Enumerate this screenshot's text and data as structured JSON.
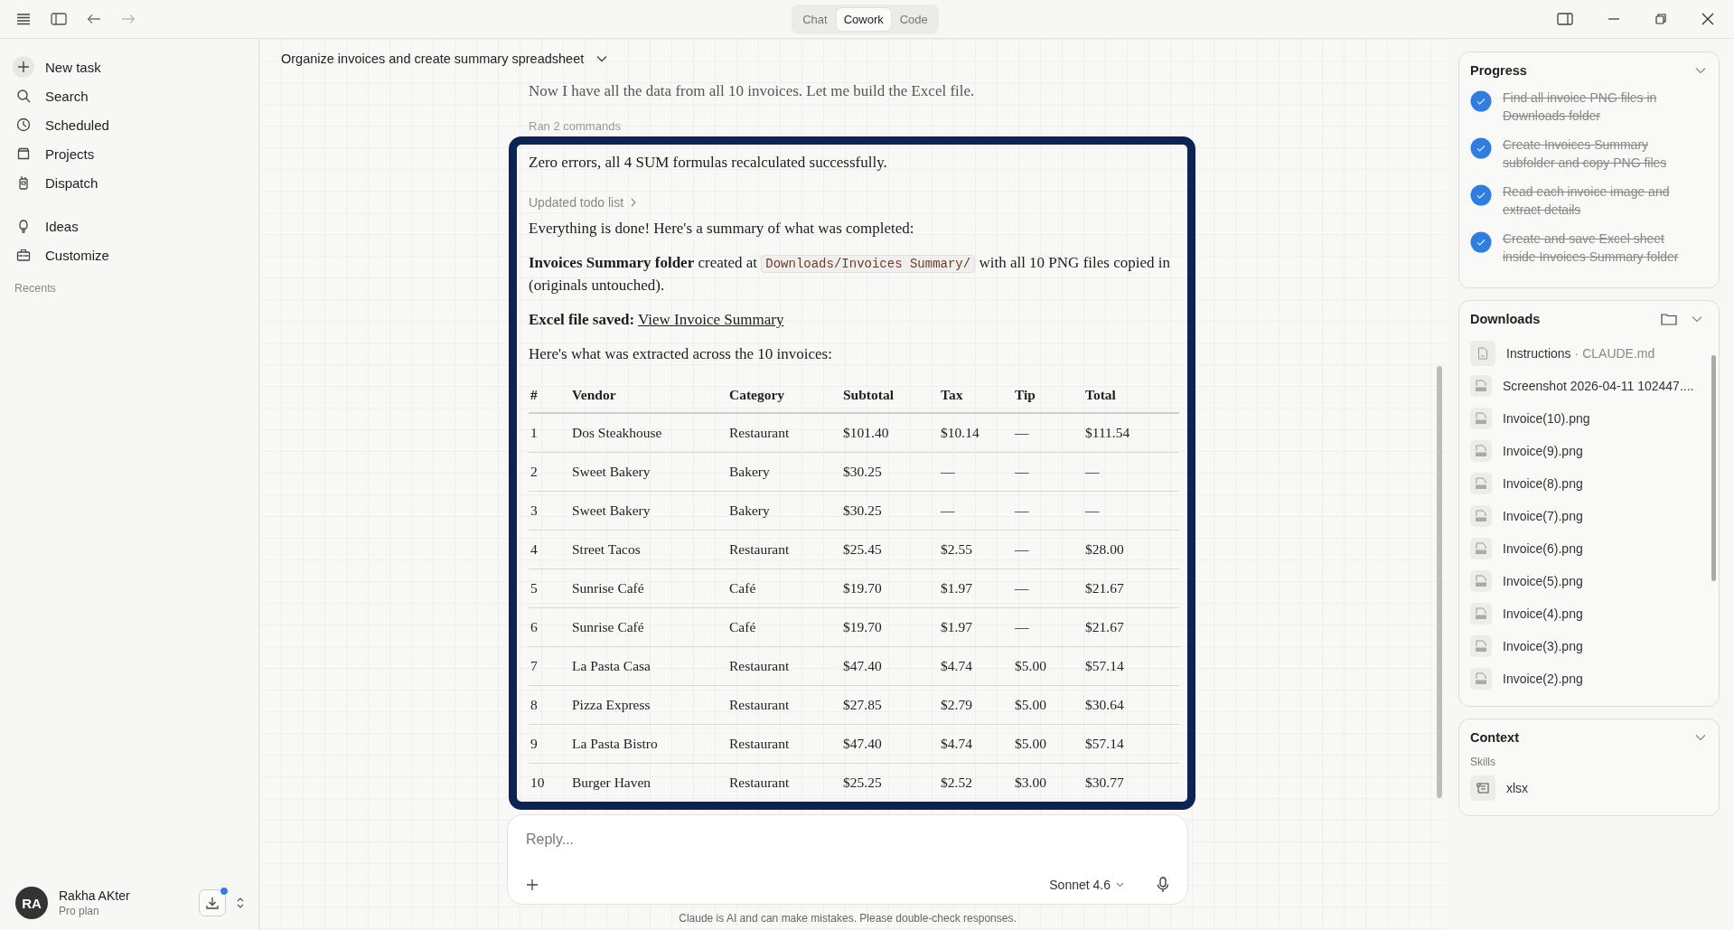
{
  "modes": [
    {
      "label": "Chat",
      "selected": false
    },
    {
      "label": "Cowork",
      "selected": true
    },
    {
      "label": "Code",
      "selected": false
    }
  ],
  "sidebar": {
    "primary": [
      {
        "label": "New task",
        "kind": "plus"
      },
      {
        "label": "Search",
        "kind": "search"
      },
      {
        "label": "Scheduled",
        "kind": "clock"
      },
      {
        "label": "Projects",
        "kind": "folder"
      },
      {
        "label": "Dispatch",
        "kind": "device"
      }
    ],
    "secondary": [
      {
        "label": "Ideas",
        "kind": "bulb"
      },
      {
        "label": "Customize",
        "kind": "toolbox"
      }
    ],
    "recents_label": "Recents",
    "user": {
      "initials": "RA",
      "name": "Rakha AKter",
      "plan": "Pro plan"
    }
  },
  "task_title": "Organize invoices and create summary spreadsheet",
  "chat": {
    "intro": "Now I have all the data from all 10 invoices. Let me build the Excel file.",
    "ran_commands": "Ran 2 commands",
    "result_line": "Zero errors, all 4 SUM formulas recalculated successfully.",
    "todo_link": "Updated todo list",
    "summary_line": "Everything is done! Here's a summary of what was completed:",
    "folder_line": {
      "bold": "Invoices Summary folder",
      "before_code": " created at ",
      "code": "Downloads/Invoices Summary/",
      "after_code": " with all 10 PNG files copied in (originals untouched)."
    },
    "excel_line": {
      "bold": "Excel file saved:",
      "link": "View Invoice Summary"
    },
    "extracted_line": "Here's what was extracted across the 10 invoices:",
    "table": {
      "columns": [
        "#",
        "Vendor",
        "Category",
        "Subtotal",
        "Tax",
        "Tip",
        "Total"
      ],
      "rows": [
        [
          "1",
          "Dos Steakhouse",
          "Restaurant",
          "$101.40",
          "$10.14",
          "—",
          "$111.54"
        ],
        [
          "2",
          "Sweet Bakery",
          "Bakery",
          "$30.25",
          "—",
          "—",
          "—"
        ],
        [
          "3",
          "Sweet Bakery",
          "Bakery",
          "$30.25",
          "—",
          "—",
          "—"
        ],
        [
          "4",
          "Street Tacos",
          "Restaurant",
          "$25.45",
          "$2.55",
          "—",
          "$28.00"
        ],
        [
          "5",
          "Sunrise Café",
          "Café",
          "$19.70",
          "$1.97",
          "—",
          "$21.67"
        ],
        [
          "6",
          "Sunrise Café",
          "Café",
          "$19.70",
          "$1.97",
          "—",
          "$21.67"
        ],
        [
          "7",
          "La Pasta Casa",
          "Restaurant",
          "$47.40",
          "$4.74",
          "$5.00",
          "$57.14"
        ],
        [
          "8",
          "Pizza Express",
          "Restaurant",
          "$27.85",
          "$2.79",
          "$5.00",
          "$30.64"
        ],
        [
          "9",
          "La Pasta Bistro",
          "Restaurant",
          "$47.40",
          "$4.74",
          "$5.00",
          "$57.14"
        ],
        [
          "10",
          "Burger Haven",
          "Restaurant",
          "$25.25",
          "$2.52",
          "$3.00",
          "$30.77"
        ]
      ]
    }
  },
  "reply": {
    "placeholder": "Reply...",
    "model": "Sonnet 4.6",
    "disclaimer": "Claude is AI and can make mistakes. Please double-check responses."
  },
  "progress": {
    "title": "Progress",
    "items": [
      {
        "text": "Find all invoice PNG files in Downloads folder",
        "done": true
      },
      {
        "text": "Create Invoices Summary subfolder and copy PNG files",
        "done": true
      },
      {
        "text": "Read each invoice image and extract details",
        "done": true
      },
      {
        "text": "Create and save Excel sheet inside Invoices Summary folder",
        "done": true
      }
    ]
  },
  "downloads": {
    "title": "Downloads",
    "items": [
      {
        "kind": "md",
        "name": "Instructions",
        "detail": "· CLAUDE.md"
      },
      {
        "kind": "png",
        "name": "Screenshot 2026-04-11 102447...."
      },
      {
        "kind": "png",
        "name": "Invoice(10).png"
      },
      {
        "kind": "png",
        "name": "Invoice(9).png"
      },
      {
        "kind": "png",
        "name": "Invoice(8).png"
      },
      {
        "kind": "png",
        "name": "Invoice(7).png"
      },
      {
        "kind": "png",
        "name": "Invoice(6).png"
      },
      {
        "kind": "png",
        "name": "Invoice(5).png"
      },
      {
        "kind": "png",
        "name": "Invoice(4).png"
      },
      {
        "kind": "png",
        "name": "Invoice(3).png"
      },
      {
        "kind": "png",
        "name": "Invoice(2).png"
      }
    ]
  },
  "context": {
    "title": "Context",
    "section": "Skills",
    "skills": [
      "xlsx"
    ]
  }
}
